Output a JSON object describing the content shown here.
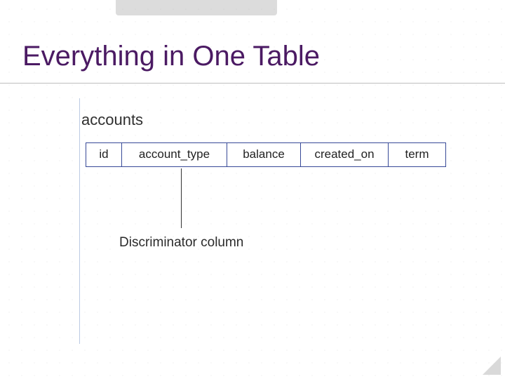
{
  "title": "Everything in One Table",
  "table_name": "accounts",
  "columns": {
    "id": "id",
    "account_type": "account_type",
    "balance": "balance",
    "created_on": "created_on",
    "term": "term"
  },
  "annotation": "Discriminator column"
}
